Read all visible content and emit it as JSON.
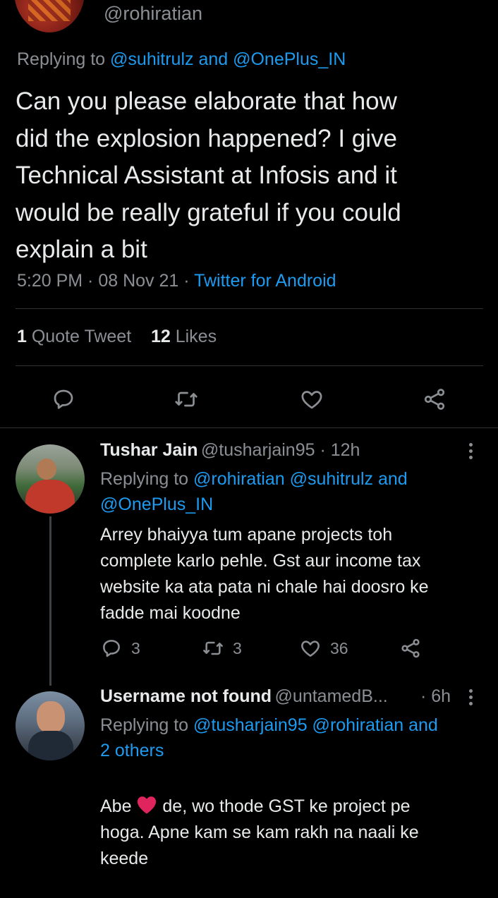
{
  "main_tweet": {
    "handle": "@rohiratian",
    "replying_prefix": "Replying to",
    "replying_to": "@suhitrulz and @OnePlus_IN",
    "text": "Can you please elaborate that how\ndid the explosion happened? I give\nTechnical Assistant at  Infosis and it\nwould be really grateful if you could\nexplain a bit",
    "time": "5:20 PM · 08 Nov 21 · ",
    "source": "Twitter for Android",
    "quote_count": "1",
    "quote_label": "Quote Tweet",
    "likes_count": "12",
    "likes_label": "Likes",
    "icons": [
      "reply-icon",
      "retweet-icon",
      "like-icon",
      "share-icon"
    ]
  },
  "replies": [
    {
      "name": "Tushar Jain",
      "handle": "@tusharjain95 · 12h",
      "replying_prefix": "Replying to",
      "replying_line1": "@rohiratian @suhitrulz and",
      "replying_line2": "@OnePlus_IN",
      "text": "Arrey bhaiyya tum apane projects toh\ncomplete karlo pehle. Gst aur income tax\nwebsite ka ata pata ni chale hai doosro ke\nfadde mai koodne",
      "reply_count": "3",
      "retweet_count": "3",
      "like_count": "36"
    },
    {
      "name": "Username not found",
      "handle": "@untamedB...",
      "time": "· 6h",
      "replying_prefix": "Replying to",
      "replying_line1": "@tusharjain95 @rohiratian and",
      "replying_line2": "2 others",
      "text_before_heart": "Abe ",
      "text_after_heart": "de, wo thode GST ke project pe",
      "text_rest": "hoga. Apne kam se kam rakh na naali ke\nkeede"
    }
  ],
  "colors": {
    "background": "#000000",
    "link_blue": "#1d9bf0",
    "secondary_gray": "#8b8f94",
    "heart_red": "#e0245e"
  }
}
